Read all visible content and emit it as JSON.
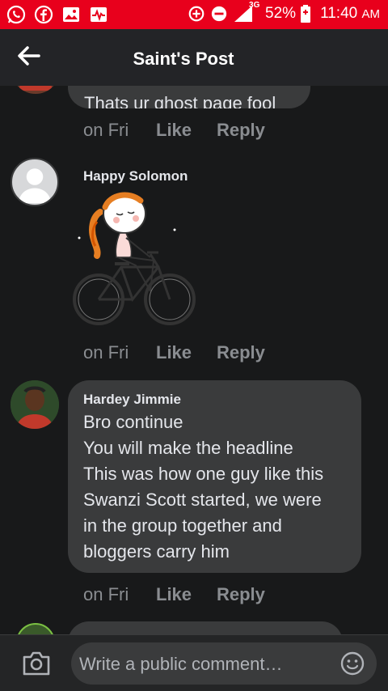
{
  "status_bar": {
    "notification_icons": [
      "whatsapp-icon",
      "facebook-icon",
      "gallery-icon",
      "activity-icon"
    ],
    "battery_percent": "52%",
    "time": "11:40",
    "ampm": "AM",
    "network": "3G"
  },
  "header": {
    "title": "Saint's Post",
    "back_icon": "arrow-left-icon"
  },
  "comments": [
    {
      "author": "",
      "text": "Thats ur ghost page fool",
      "time": "on Fri",
      "like_label": "Like",
      "reply_label": "Reply"
    },
    {
      "author": "Happy Solomon",
      "sticker": "girl-on-bicycle-sticker",
      "time": "on Fri",
      "like_label": "Like",
      "reply_label": "Reply"
    },
    {
      "author": "Hardey Jimmie",
      "lines": [
        "Bro continue",
        "You will make the headline",
        "This was how one guy like this",
        "Swanzi Scott started, we were",
        "in the group together and",
        "bloggers carry him"
      ],
      "time": "on Fri",
      "like_label": "Like",
      "reply_label": "Reply"
    }
  ],
  "composer": {
    "placeholder": "Write a public comment…",
    "camera_icon": "camera-icon",
    "emoji_icon": "smiley-icon"
  },
  "colors": {
    "status_bar": "#e8001c",
    "background": "#18191a",
    "bubble": "#3a3b3c",
    "meta_text": "#8a8d91"
  }
}
